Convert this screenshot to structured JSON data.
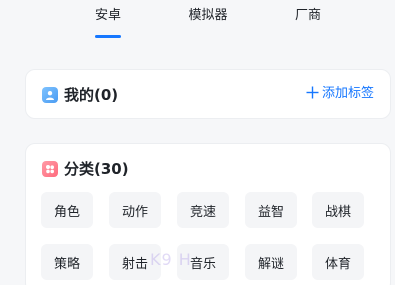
{
  "tabs": [
    {
      "label": "安卓",
      "active": true
    },
    {
      "label": "模拟器",
      "active": false
    },
    {
      "label": "厂商",
      "active": false
    }
  ],
  "mine": {
    "title": "我的(0)",
    "icon": "user-icon",
    "add_tag_icon": "plus-icon",
    "add_tag_label": "添加标签"
  },
  "category": {
    "title": "分类(30)",
    "icon": "category-icon",
    "tags": [
      "角色",
      "动作",
      "竞速",
      "益智",
      "战棋",
      "策略",
      "射击",
      "音乐",
      "解谜",
      "体育"
    ]
  },
  "watermark": "K9 H",
  "colors": {
    "accent": "#1677ff",
    "background": "#f6f7f9",
    "card": "#ffffff",
    "tag_bg": "#f4f5f7",
    "user_icon": "#4a9bf2",
    "category_icon": "#ff6b7d"
  }
}
